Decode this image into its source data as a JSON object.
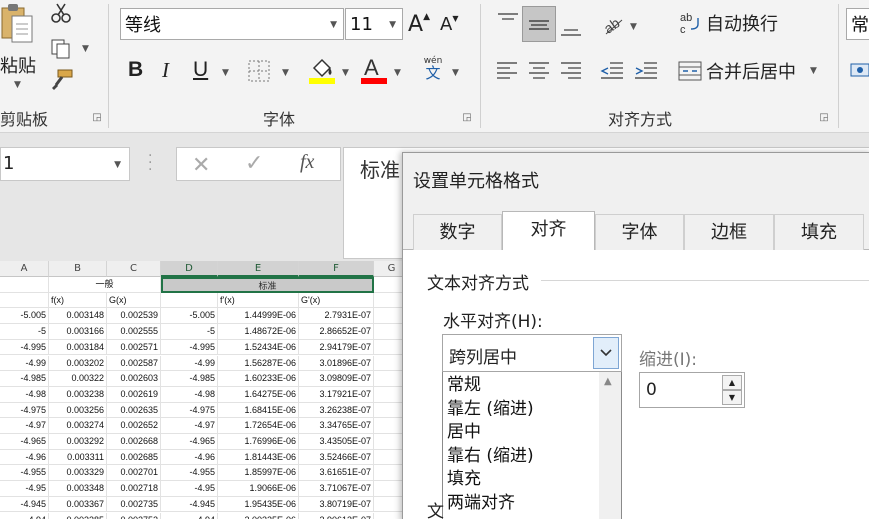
{
  "ribbon": {
    "clipboard": {
      "paste_label": "粘贴",
      "group_label": "剪贴板"
    },
    "font": {
      "font_name": "等线",
      "font_size": "11",
      "bold": "B",
      "italic": "I",
      "underline": "U",
      "fill_color": "#ffff00",
      "font_color": "#ff0000",
      "phonetic_top": "wén",
      "phonetic_bottom": "文",
      "group_label": "字体"
    },
    "alignment": {
      "wrap_text": "自动换行",
      "merge_center": "合并后居中",
      "group_label": "对齐方式"
    },
    "number": {
      "format_partial": "常"
    }
  },
  "formula_bar": {
    "name_box": "1",
    "fx": "fx",
    "content": "标准"
  },
  "sheet": {
    "columns": [
      "A",
      "B",
      "C",
      "D",
      "E",
      "F",
      "G"
    ],
    "row1": {
      "b_c": "一般",
      "e": "标准"
    },
    "row2": {
      "b": "f(x)",
      "c": "G(x)",
      "e": "f'(x)",
      "f": "G'(x)"
    },
    "rows": [
      [
        "-5.005",
        "0.003148",
        "0.002539",
        "-5.005",
        "1.44999E-06",
        "2.7931E-07"
      ],
      [
        "-5",
        "0.003166",
        "0.002555",
        "-5",
        "1.48672E-06",
        "2.86652E-07"
      ],
      [
        "-4.995",
        "0.003184",
        "0.002571",
        "-4.995",
        "1.52434E-06",
        "2.94179E-07"
      ],
      [
        "-4.99",
        "0.003202",
        "0.002587",
        "-4.99",
        "1.56287E-06",
        "3.01896E-07"
      ],
      [
        "-4.985",
        "0.00322",
        "0.002603",
        "-4.985",
        "1.60233E-06",
        "3.09809E-07"
      ],
      [
        "-4.98",
        "0.003238",
        "0.002619",
        "-4.98",
        "1.64275E-06",
        "3.17921E-07"
      ],
      [
        "-4.975",
        "0.003256",
        "0.002635",
        "-4.975",
        "1.68415E-06",
        "3.26238E-07"
      ],
      [
        "-4.97",
        "0.003274",
        "0.002652",
        "-4.97",
        "1.72654E-06",
        "3.34765E-07"
      ],
      [
        "-4.965",
        "0.003292",
        "0.002668",
        "-4.965",
        "1.76996E-06",
        "3.43505E-07"
      ],
      [
        "-4.96",
        "0.003311",
        "0.002685",
        "-4.96",
        "1.81443E-06",
        "3.52466E-07"
      ],
      [
        "-4.955",
        "0.003329",
        "0.002701",
        "-4.955",
        "1.85997E-06",
        "3.61651E-07"
      ],
      [
        "-4.95",
        "0.003348",
        "0.002718",
        "-4.95",
        "1.9066E-06",
        "3.71067E-07"
      ],
      [
        "-4.945",
        "0.003367",
        "0.002735",
        "-4.945",
        "1.95435E-06",
        "3.80719E-07"
      ],
      [
        "-4.94",
        "0.003385",
        "0.002752",
        "-4.94",
        "2.00325E-06",
        "3.90613E-07"
      ]
    ]
  },
  "dialog": {
    "title": "设置单元格格式",
    "tabs": [
      "数字",
      "对齐",
      "字体",
      "边框",
      "填充"
    ],
    "section_label": "文本对齐方式",
    "horizontal_label": "水平对齐(H):",
    "horizontal_value": "跨列居中",
    "indent_label": "缩进(I):",
    "indent_value": "0",
    "options": [
      "常规",
      "靠左 (缩进)",
      "居中",
      "靠右 (缩进)",
      "填充",
      "两端对齐"
    ],
    "bottom_partial": "文"
  }
}
